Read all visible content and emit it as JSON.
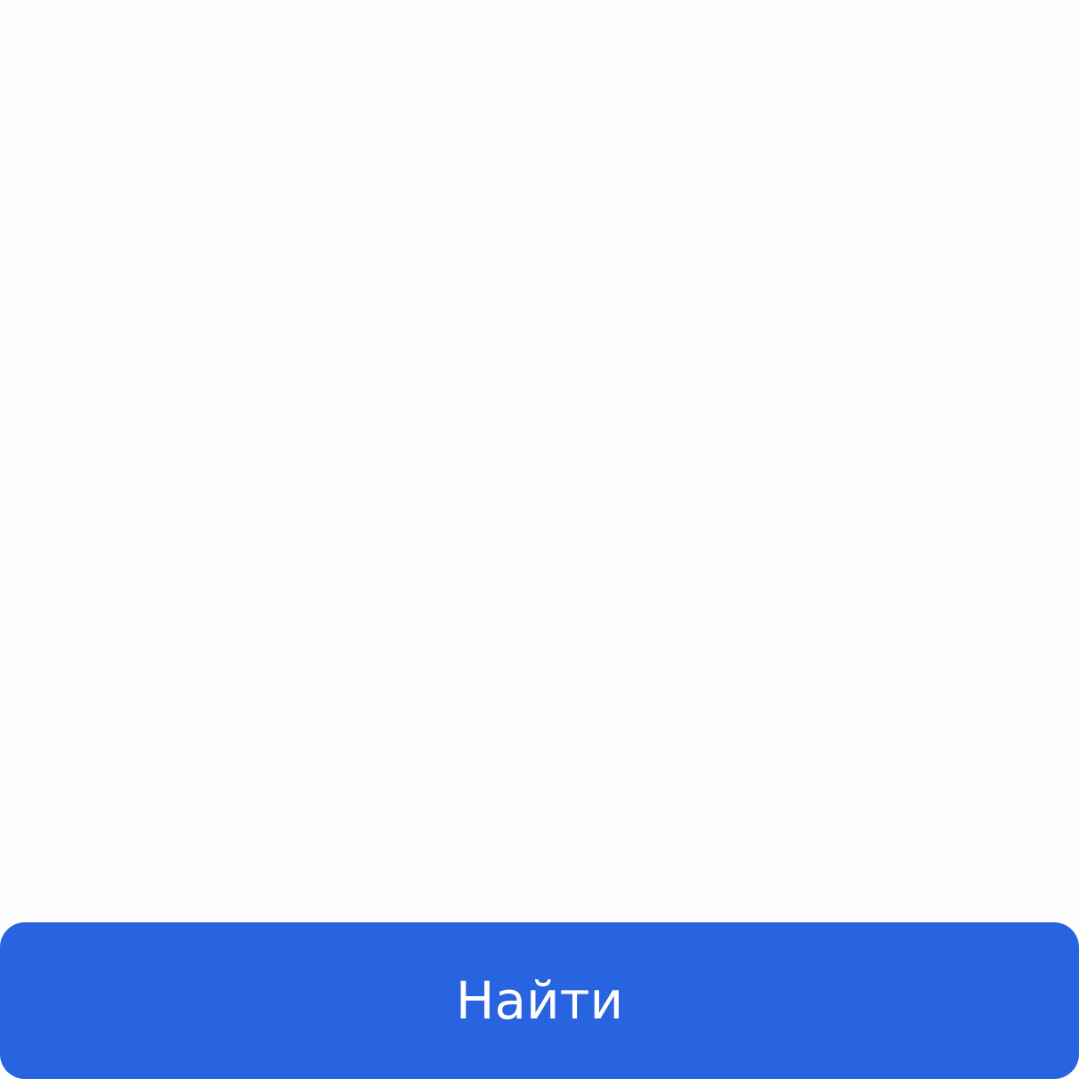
{
  "search_button": {
    "label": "Найти",
    "background_color": "#2864e0",
    "text_color": "#ffffff"
  }
}
